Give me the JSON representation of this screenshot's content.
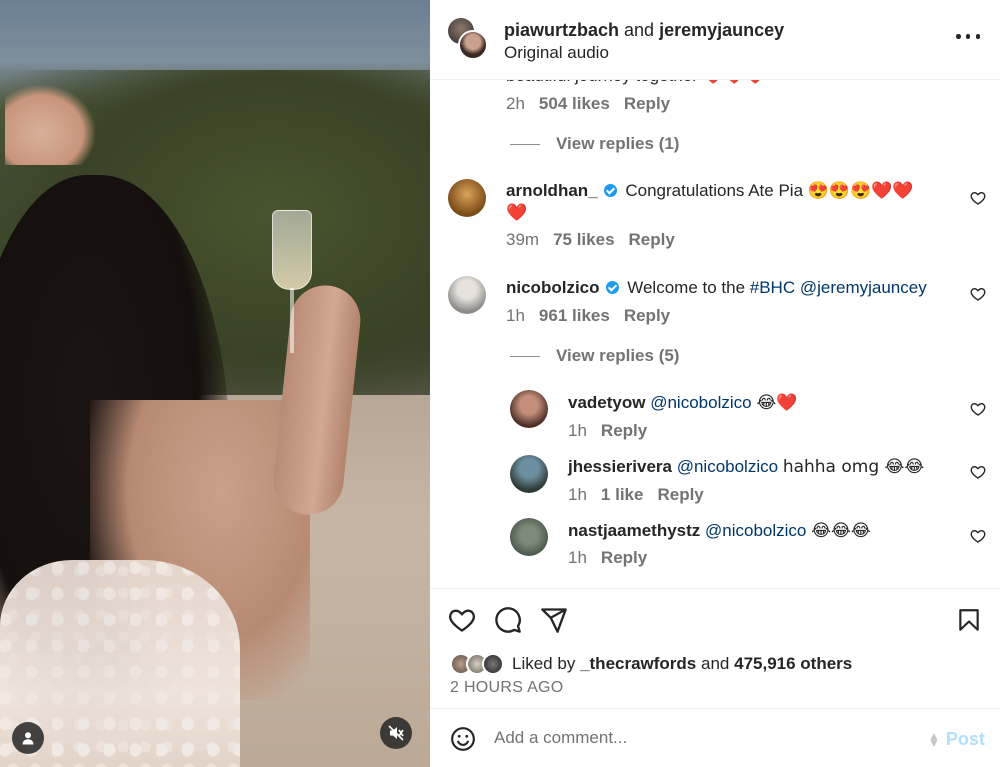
{
  "header": {
    "user1": "piawurtzbach",
    "joiner": "and",
    "user2": "jeremyjauncey",
    "subtitle": "Original audio"
  },
  "clipped_comment": {
    "text": "beautiful journey together ❤️❤️❤️",
    "time": "2h",
    "likes": "504 likes",
    "reply": "Reply",
    "view_replies": "View replies (1)"
  },
  "comments": [
    {
      "username": "arnoldhan_",
      "verified": true,
      "text": "Congratulations Ate Pia 😍😍😍❤️❤️",
      "text_line2": "❤️",
      "time": "39m",
      "likes": "75 likes",
      "reply": "Reply"
    },
    {
      "username": "nicobolzico",
      "verified": true,
      "text_prefix": "Welcome to the",
      "hashtag": "#BHC",
      "mention": "@jeremyjauncey",
      "time": "1h",
      "likes": "961 likes",
      "reply": "Reply",
      "view_replies": "View replies (5)"
    }
  ],
  "replies": [
    {
      "username": "vadetyow",
      "mention": "@nicobolzico",
      "text": "😂❤️",
      "time": "1h",
      "reply": "Reply"
    },
    {
      "username": "jhessierivera",
      "mention": "@nicobolzico",
      "text": "hahha omg 😂😂",
      "time": "1h",
      "likes": "1 like",
      "reply": "Reply"
    },
    {
      "username": "nastjaamethystz",
      "mention": "@nicobolzico",
      "text": "😂😂😂",
      "time": "1h",
      "reply": "Reply"
    }
  ],
  "likes_summary": {
    "prefix": "Liked by",
    "user": "_thecrawfords",
    "joiner": "and",
    "others": "475,916 others"
  },
  "time_ago": "2 HOURS AGO",
  "comment_box": {
    "placeholder": "Add a comment...",
    "post_label": "Post"
  },
  "icons": {
    "like": "heart-icon",
    "comment": "comment-bubble-icon",
    "share": "paper-plane-icon",
    "save": "bookmark-icon",
    "emoji": "smiley-icon",
    "mute": "speaker-muted-icon",
    "user_tags": "person-icon",
    "more": "ellipsis-icon"
  },
  "colors": {
    "link_blue": "#00376b",
    "verified_blue": "#1d9bf0",
    "post_button_disabled": "#b2dffc",
    "secondary_text": "#737373"
  }
}
